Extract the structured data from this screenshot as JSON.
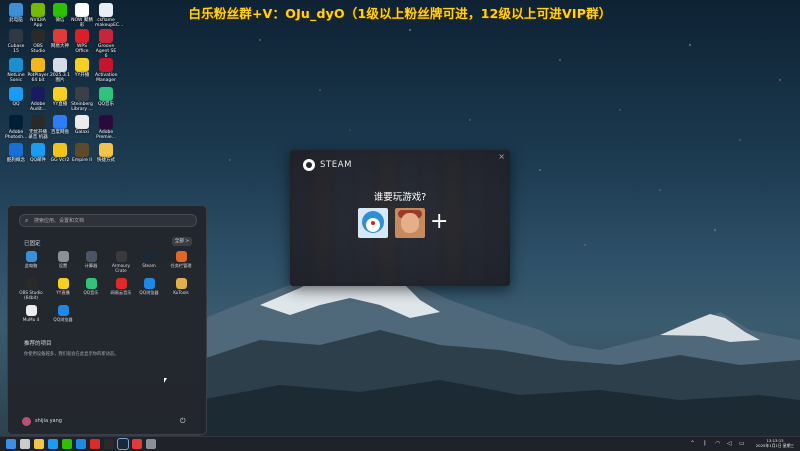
{
  "banner": "白乐粉丝群+V：OJu_dyO（1级以上粉丝牌可进，12级以上可进VIP群）",
  "desktop_icons": [
    {
      "label": "此电脑",
      "icon": "computer-icon",
      "color": "#3d8fd6"
    },
    {
      "label": "NVIDIA App",
      "icon": "nvidia-icon",
      "color": "#76b900"
    },
    {
      "label": "微信",
      "icon": "wechat-icon",
      "color": "#2dc100"
    },
    {
      "label": "NOW 聚精彩",
      "icon": "now-icon",
      "color": "#ffffff"
    },
    {
      "label": "csflame makeupEC...",
      "icon": "document-icon",
      "color": "#e8eef5"
    },
    {
      "label": "Cubase 15",
      "icon": "cubase-icon",
      "color": "#303846"
    },
    {
      "label": "OBS Studio",
      "icon": "obs-icon",
      "color": "#2a2a2a"
    },
    {
      "label": "网易大神",
      "icon": "netease-icon",
      "color": "#e03a3a"
    },
    {
      "label": "WPS Office",
      "icon": "wps-icon",
      "color": "#d9202a"
    },
    {
      "label": "Groove Agent SE 6",
      "icon": "groove-agent-icon",
      "color": "#c7263a"
    },
    {
      "label": "NetLine Sonic",
      "icon": "netline-icon",
      "color": "#1d8fd0"
    },
    {
      "label": "PotPlayer 64 bit",
      "icon": "potplayer-icon",
      "color": "#f2b71d"
    },
    {
      "label": "2025.3.1 图片",
      "icon": "image-icon",
      "color": "#d7dde6"
    },
    {
      "label": "YY开播",
      "icon": "yy-icon",
      "color": "#f5d020"
    },
    {
      "label": "Activation Manager",
      "icon": "activation-icon",
      "color": "#c4162a"
    },
    {
      "label": "QQ",
      "icon": "qq-icon",
      "color": "#1b9cf2"
    },
    {
      "label": "Adobe Audit...",
      "icon": "audition-icon",
      "color": "#1a1a5e"
    },
    {
      "label": "YY直播",
      "icon": "yy-live-icon",
      "color": "#f5d020"
    },
    {
      "label": "Steinberg Library ...",
      "icon": "steinberg-icon",
      "color": "#3a3f48"
    },
    {
      "label": "QQ音乐",
      "icon": "qq-music-icon",
      "color": "#31c27c"
    },
    {
      "label": "Adobe Photosh...",
      "icon": "photoshop-icon",
      "color": "#001e36"
    },
    {
      "label": "无忧开播录音 机器",
      "icon": "recorder-icon",
      "color": "#2a2a2a"
    },
    {
      "label": "百度网盘",
      "icon": "baidu-pan-icon",
      "color": "#2c7ef8"
    },
    {
      "label": "Galaxi",
      "icon": "galaxi-icon",
      "color": "#ececec"
    },
    {
      "label": "Adobe Premie...",
      "icon": "premiere-icon",
      "color": "#2a0a3e"
    },
    {
      "label": "酷狗概念",
      "icon": "kugou-icon",
      "color": "#1a6fd6"
    },
    {
      "label": "QQ邮件",
      "icon": "qq-mail-icon",
      "color": "#1b9cf2"
    },
    {
      "label": "GG Vcr2",
      "icon": "ggvcr-icon",
      "color": "#f0c419"
    },
    {
      "label": "Empire II",
      "icon": "empire-icon",
      "color": "#5c4a2a"
    },
    {
      "label": "快捷方式",
      "icon": "folder-icon",
      "color": "#f3c44a"
    }
  ],
  "steam": {
    "brand": "STEAM",
    "question": "谁要玩游戏?",
    "close": "×",
    "add": "+"
  },
  "start_menu": {
    "search_placeholder": "搜索应用、设置和文档",
    "pinned_label": "已固定",
    "all_button": "全部 >",
    "pinned": [
      {
        "label": "此电脑",
        "icon": "computer-icon",
        "color": "#3d8fd6"
      },
      {
        "label": "设置",
        "icon": "settings-icon",
        "color": "#8a8f99"
      },
      {
        "label": "计算器",
        "icon": "calculator-icon",
        "color": "#4c5563"
      },
      {
        "label": "Armoury Crate",
        "icon": "armoury-crate-icon",
        "color": "#3a3a3a"
      },
      {
        "label": "Steam",
        "icon": "steam-icon",
        "color": "#1b2838"
      },
      {
        "label": "任务栏管理",
        "icon": "taskbar-manager-icon",
        "color": "#e0662a"
      },
      {
        "label": "OBS Studio (64bit)",
        "icon": "obs-icon",
        "color": "#2a2a2a"
      },
      {
        "label": "YY直播",
        "icon": "yy-icon",
        "color": "#f5d020"
      },
      {
        "label": "QQ音乐",
        "icon": "qq-music-icon",
        "color": "#31c27c"
      },
      {
        "label": "网易云音乐",
        "icon": "netease-music-icon",
        "color": "#e02a2a"
      },
      {
        "label": "QQ浏览器",
        "icon": "qq-browser-icon",
        "color": "#1e88e5"
      },
      {
        "label": "KuTools",
        "icon": "kutools-icon",
        "color": "#e2b04a"
      },
      {
        "label": "MuMu 4",
        "icon": "mumu-icon",
        "color": "#ececec"
      },
      {
        "label": "QQ浏览器",
        "icon": "qq-browser-icon",
        "color": "#1e88e5"
      }
    ],
    "recommended_label": "推荐的项目",
    "recommended_text": "你使用设备越多，我们就会在此显示你的新动态。",
    "user_name": "shijia yang",
    "power": "⏻"
  },
  "taskbar": {
    "apps": [
      {
        "icon": "windows-start-icon",
        "color": "#3a8fe8"
      },
      {
        "icon": "search-icon",
        "color": "#cccccc"
      },
      {
        "icon": "file-explorer-icon",
        "color": "#f3c44a"
      },
      {
        "icon": "qq-icon",
        "color": "#1b9cf2"
      },
      {
        "icon": "wechat-icon",
        "color": "#2dc100"
      },
      {
        "icon": "edge-icon",
        "color": "#1e88e5"
      },
      {
        "icon": "netease-music-icon",
        "color": "#e02a2a"
      },
      {
        "icon": "obs-icon",
        "color": "#2a2a2a"
      },
      {
        "icon": "steam-icon",
        "color": "#1b2838"
      },
      {
        "icon": "netease-icon",
        "color": "#e03a3a"
      },
      {
        "icon": "settings-icon",
        "color": "#8a8f99"
      }
    ],
    "clock_time": "13:13:13",
    "clock_date": "2025年1月1日 星期三"
  }
}
